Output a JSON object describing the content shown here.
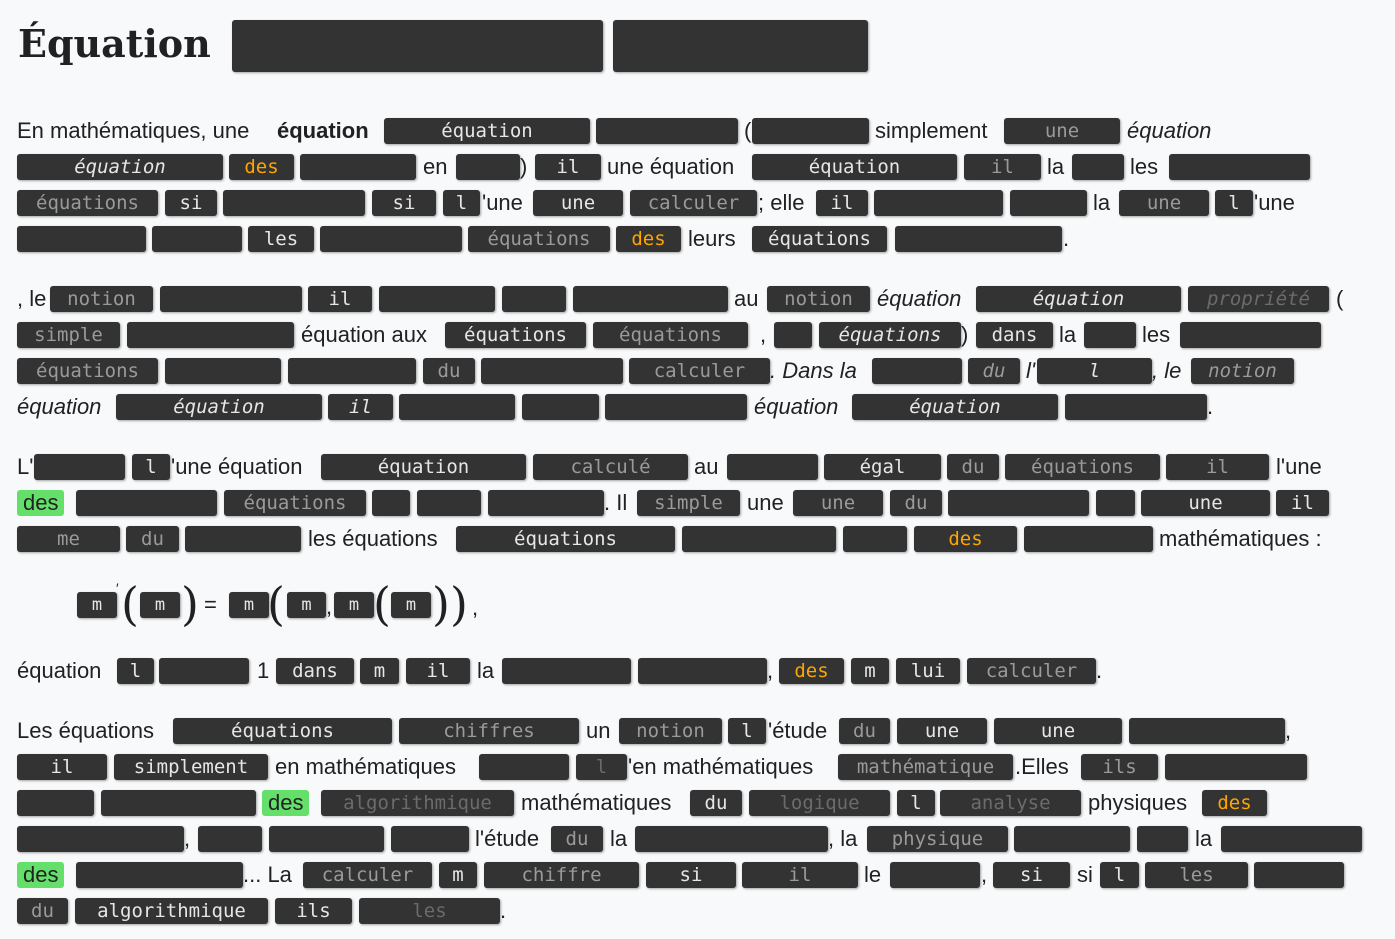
{
  "title": "Équation",
  "p1": {
    "t1": "En mathématiques, une",
    "t_bold": "équation",
    "open_paren": "(",
    "simplement": "simplement",
    "equation_it": "équation",
    "en": "en",
    "close_paren": ")",
    "une_equation": "une équation",
    "la": "la",
    "les": "les",
    "une_apos": "'une",
    "elle": "; elle",
    "la2": "la",
    "une_apos2": "'une",
    "leurs": "leurs",
    "dot": "."
  },
  "p2": {
    "le": ", le",
    "au": "au",
    "equation_it": "équation",
    "open_paren": "(",
    "equation_aux": "équation aux",
    "comma": ",",
    "close_paren": ")",
    "la": "la",
    "les": "les",
    "dans_la": ". Dans la",
    "l_apos": "l'",
    "equation_it2": "équation",
    "equation_it3": "équation",
    "dot": "."
  },
  "p3": {
    "l_apos": "L'",
    "une_equation": "'une équation",
    "au": "au",
    "lune": "l'une",
    "des": "des",
    "il": ". Il",
    "une": "une",
    "les_equations": "les équations",
    "mathematiques": "mathématiques :"
  },
  "formula": {
    "eq": "=",
    "comma": ","
  },
  "p4": {
    "equation": "équation",
    "one": "1",
    "la": "la",
    "comma": ",",
    "dot": "."
  },
  "p5": {
    "les_equations": "Les équations",
    "un": "un",
    "letude": "'étude",
    "comma": ",",
    "en_math": "en mathématiques",
    "en_math2": "'en mathématiques",
    "elles": ".Elles",
    "des": "des",
    "mathematiques": "mathématiques",
    "physiques": "physiques",
    "comma2": ",",
    "letude2": "l'étude",
    "la": "la",
    "la_comma": ", la",
    "la2": "la",
    "des2": "des",
    "la_dots": "... La",
    "le": "le",
    "comma3": ",",
    "si": "si",
    "dot": "."
  },
  "words": {
    "equation": "équation",
    "des": "des",
    "il": "il",
    "une": "une",
    "equations": "équations",
    "si": "si",
    "l": "l",
    "calculer": "calculer",
    "les": "les",
    "notion": "notion",
    "propriete": "propriété",
    "simple": "simple",
    "dans": "dans",
    "du": "du",
    "calcule": "calculé",
    "egal": "égal",
    "me": "me",
    "m": "m",
    "lui": "lui",
    "chiffres": "chiffres",
    "simplement": "simplement",
    "mathematique": "mathématique",
    "ils": "ils",
    "algorithmique": "algorithmique",
    "logique": "logique",
    "analyse": "analyse",
    "physique": "physique",
    "chiffre": "chiffre"
  }
}
